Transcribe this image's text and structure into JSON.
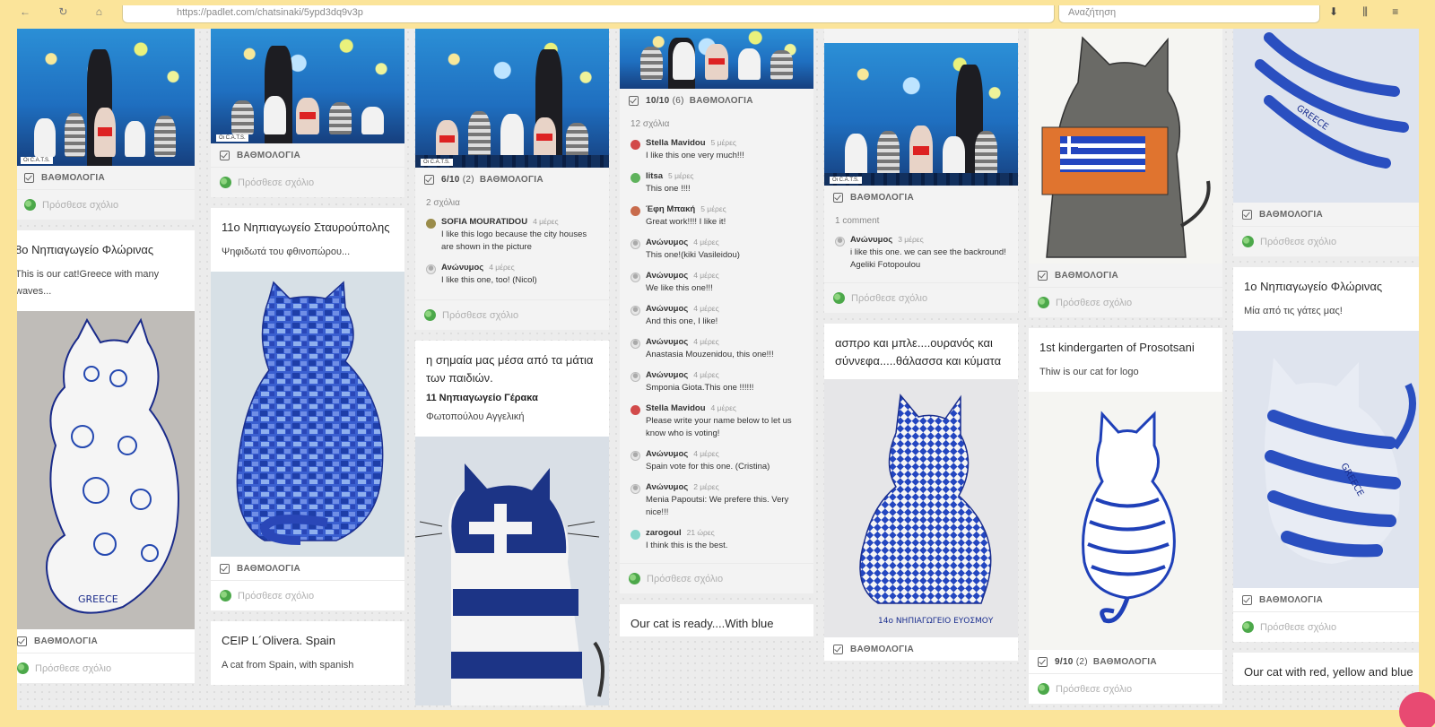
{
  "browser": {
    "url": "https://padlet.com/chatsinaki/5ypd3dq9v3p",
    "search_placeholder": "Αναζήτηση"
  },
  "score_label": "ΒΑΘΜΟΛΟΓΙΑ",
  "add_comment": "Πρόσθεσε σχόλιο",
  "col1": {
    "card2_title": "8ο Νηπιαγωγείο Φλώρινας",
    "card2_body": "This is our cat!Greece with many waves...",
    "card2_img_text": "GREECE"
  },
  "col2": {
    "card2_title": "11ο Νηπιαγωγείο Σταυρούπολης",
    "card2_body": "Ψηφιδωτά του φθινοπώρου...",
    "card3_title": "CEIP L´Olivera. Spain",
    "card3_body": "A cat from Spain, with spanish"
  },
  "col3": {
    "score_value": "6/10",
    "score_count": "(2)",
    "comments_count": "2 σχόλια",
    "comments": [
      {
        "name": "SOFIA MOURATIDOU",
        "time": "4 μέρες",
        "text": "I like this logo because the city houses are shown in the picture"
      },
      {
        "name": "Ανώνυμος",
        "time": "4 μέρες",
        "text": "I like this one, too! (Nicol)"
      }
    ],
    "card2_title": "η σημαία μας μέσα από τα μάτια των παιδιών.",
    "card2_sub": "11 Νηπιαγωγείο Γέρακα",
    "card2_body": "Φωτοπούλου Αγγελική"
  },
  "col4": {
    "score_value": "10/10",
    "score_count": "(6)",
    "comments_count": "12 σχόλια",
    "comments": [
      {
        "name": "Stella Mavidou",
        "time": "5 μέρες",
        "text": "I like this one very much!!!",
        "av": "red"
      },
      {
        "name": "litsa",
        "time": "5 μέρες",
        "text": "This one !!!!",
        "av": "green"
      },
      {
        "name": "Έφη Μπακή",
        "time": "5 μέρες",
        "text": "Great work!!!! I like it!",
        "av": "face"
      },
      {
        "name": "Ανώνυμος",
        "time": "4 μέρες",
        "text": "This one!(kiki Vasileidou)",
        "av": "anon"
      },
      {
        "name": "Ανώνυμος",
        "time": "4 μέρες",
        "text": "We like this one!!!",
        "av": "anon"
      },
      {
        "name": "Ανώνυμος",
        "time": "4 μέρες",
        "text": "And this one, I like!",
        "av": "anon"
      },
      {
        "name": "Ανώνυμος",
        "time": "4 μέρες",
        "text": "Anastasia Mouzenidou, this one!!!",
        "av": "anon"
      },
      {
        "name": "Ανώνυμος",
        "time": "4 μέρες",
        "text": "Smponia Giota.This one !!!!!!",
        "av": "anon"
      },
      {
        "name": "Stella Mavidou",
        "time": "4 μέρες",
        "text": "Please write your name below to let us know who is voting!",
        "av": "red"
      },
      {
        "name": "Ανώνυμος",
        "time": "4 μέρες",
        "text": "Spain vote for this one. (Cristina)",
        "av": "anon"
      },
      {
        "name": "Ανώνυμος",
        "time": "2 μέρες",
        "text": "Menia Papoutsi: We prefere this. Very nice!!!",
        "av": "anon"
      },
      {
        "name": "zarogoul",
        "time": "21 ώρες",
        "text": "I think this is the best.",
        "av": "mint"
      }
    ],
    "card2_title": "Our cat is ready....With blue"
  },
  "col5": {
    "comments_count": "1 comment",
    "comments": [
      {
        "name": "Ανώνυμος",
        "time": "3 μέρες",
        "text": "i like this one. we can see the backround! Ageliki Fotopoulou"
      }
    ],
    "card2_title": "ασπρο και μπλε....ουρανός και σύννεφα.....θάλασσα και κύματα",
    "card2_img_text": "14ο ΝΗΠΙΑΓΩΓΕΙΟ ΕΥΟΣΜΟΥ"
  },
  "col6": {
    "card2_title": "1st kindergarten of Prosotsani",
    "card2_body": "Thiw is our cat for logo",
    "score_value": "9/10",
    "score_count": "(2)"
  },
  "col7": {
    "card2_title": "1ο Νηπιαγωγείο Φλώρινας",
    "card2_body": "Μία από τις γάτες μας!",
    "card3_title": "Our cat with red, yellow and blue",
    "img_text": "GREECE"
  }
}
